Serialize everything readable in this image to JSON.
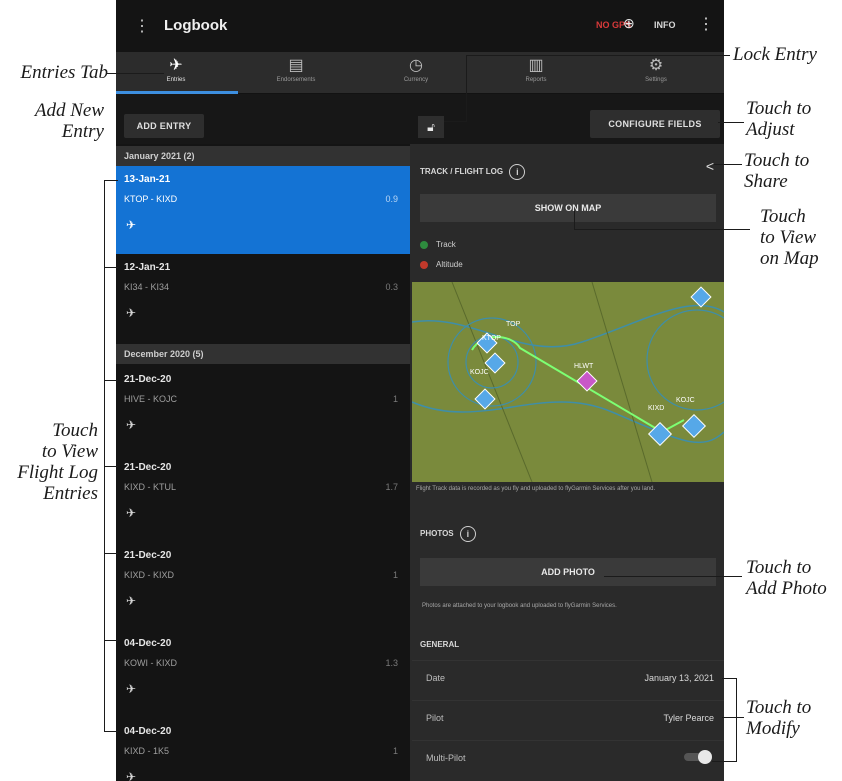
{
  "app": {
    "menu_icon": "menu-icon",
    "title": "Logbook",
    "status_left": "NO GPS",
    "status_mid_icon": "connected-device-icon",
    "status_right": "INFO",
    "more_icon": "more-vert-icon"
  },
  "tabs": [
    {
      "label": "Entries",
      "icon": "airplane-icon",
      "active": true
    },
    {
      "label": "Endorsements",
      "icon": "document-icon",
      "active": false
    },
    {
      "label": "Currency",
      "icon": "clock-icon",
      "active": false
    },
    {
      "label": "Reports",
      "icon": "bar-chart-icon",
      "active": false
    },
    {
      "label": "Settings",
      "icon": "gear-icon",
      "active": false
    }
  ],
  "toolbar": {
    "add_entry": "ADD ENTRY",
    "lock_icon": "lock-icon",
    "configure_fields": "CONFIGURE FIELDS"
  },
  "list": {
    "section1": "January 2021 (2)",
    "section2": "December 2020 (5)",
    "entries": [
      {
        "date": "13-Jan-21",
        "route": "KTOP - KIXD",
        "hours": "0.9"
      },
      {
        "date": "12-Jan-21",
        "route": "KI34 - KI34",
        "hours": "0.3"
      },
      {
        "date": "21-Dec-20",
        "route": "HIVE - KOJC",
        "hours": "1"
      },
      {
        "date": "21-Dec-20",
        "route": "KIXD - KTUL",
        "hours": "1.7"
      },
      {
        "date": "21-Dec-20",
        "route": "KIXD - KIXD",
        "hours": "1"
      },
      {
        "date": "04-Dec-20",
        "route": "KOWI - KIXD",
        "hours": "1.3"
      },
      {
        "date": "04-Dec-20",
        "route": "KIXD - 1K5",
        "hours": "1"
      }
    ]
  },
  "detail": {
    "track_header": "TRACK / FLIGHT LOG",
    "info_glyph": "i",
    "share_icon": "share-icon",
    "show_on_map": "SHOW ON MAP",
    "legend_track": "Track",
    "legend_altitude": "Altitude",
    "legend_track_color": "#2e8b3e",
    "legend_altitude_color": "#c0392b",
    "map_labels": [
      "TOP",
      "KTOP",
      "KOJC",
      "HLWT",
      "KIXD",
      "KOJC"
    ],
    "track_note": "Flight Track data is recorded as you fly and uploaded to flyGarmin Services after you land.",
    "photos_header": "PHOTOS",
    "add_photo": "ADD PHOTO",
    "photos_note": "Photos are attached to your logbook and uploaded to flyGarmin Services.",
    "general_header": "GENERAL",
    "fields": [
      {
        "key": "Date",
        "value": "January 13, 2021"
      },
      {
        "key": "Pilot",
        "value": "Tyler Pearce"
      },
      {
        "key": "Multi-Pilot",
        "value": ""
      }
    ]
  },
  "callouts": {
    "entries_tab": "Entries Tab",
    "add_new_entry": "Add New\nEntry",
    "view_flight_log": "Touch\nto View\nFlight Log\nEntries",
    "lock_entry": "Lock Entry",
    "touch_adjust": "Touch to\nAdjust",
    "touch_share": "Touch to\nShare",
    "view_on_map": "Touch\nto View\non Map",
    "add_photo": "Touch to\nAdd Photo",
    "modify": "Touch to\nModify"
  }
}
